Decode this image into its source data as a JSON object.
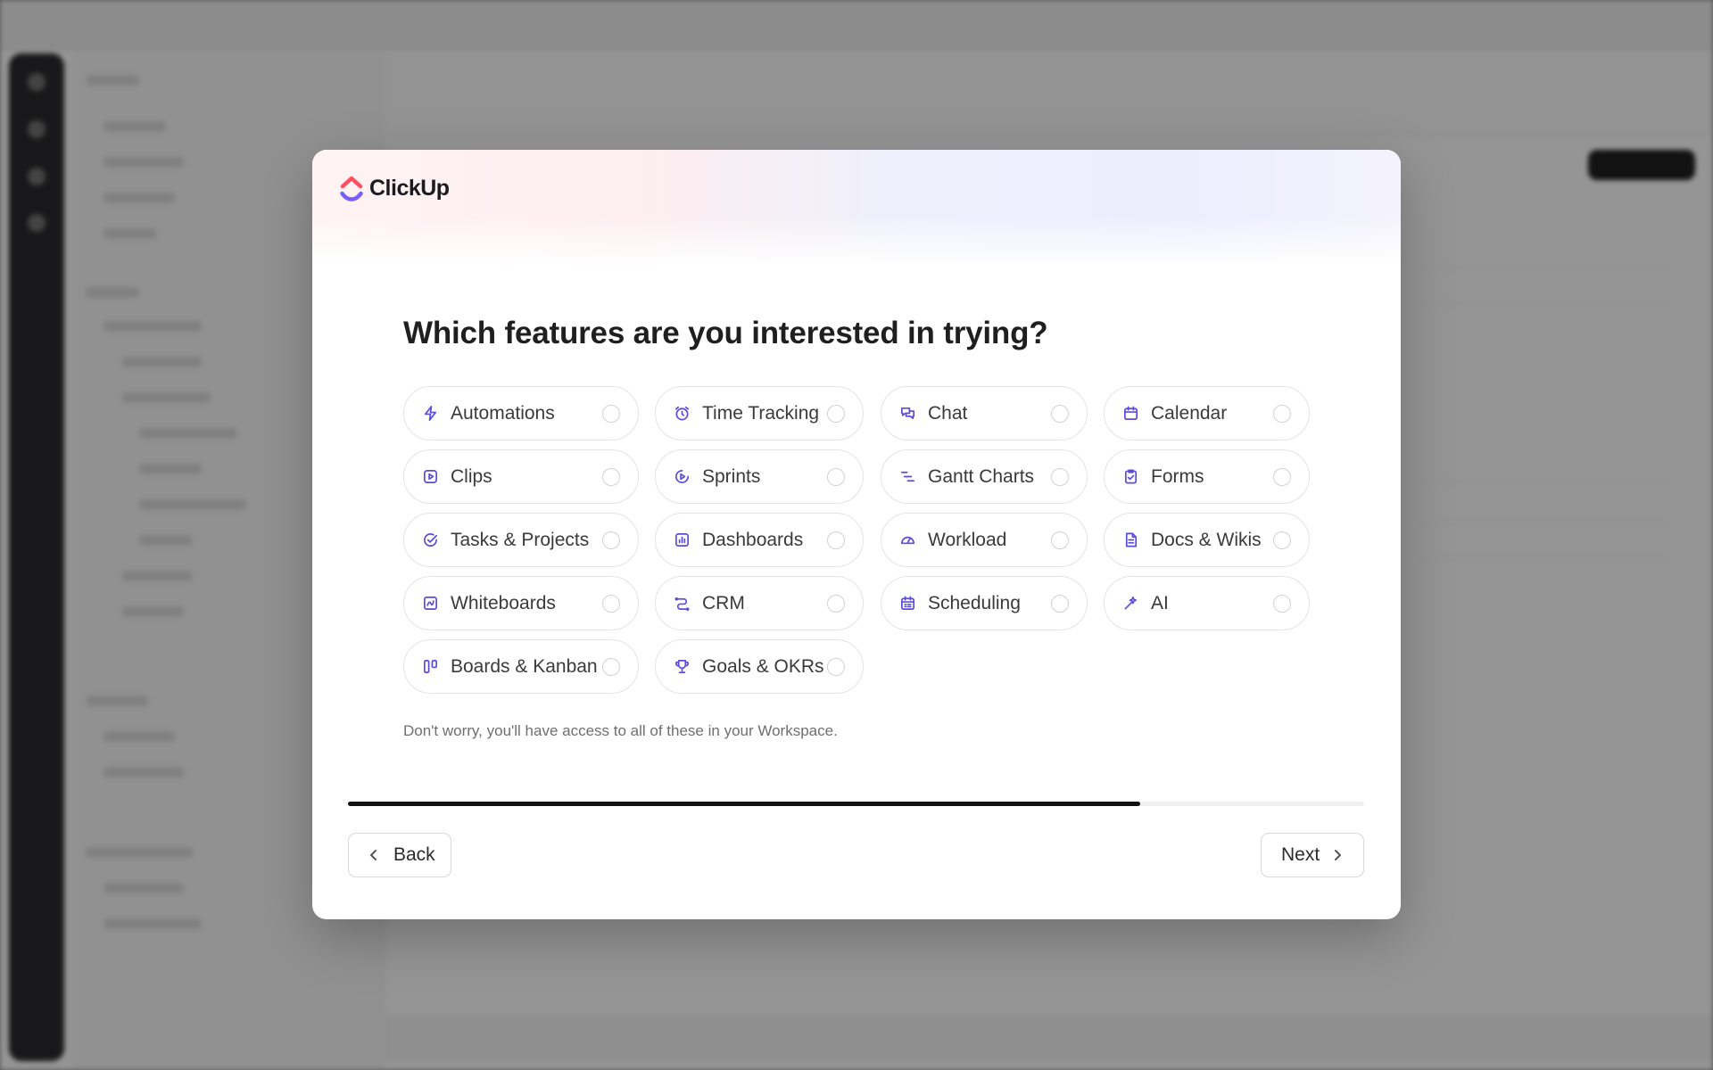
{
  "app": {
    "brand_name": "ClickUp"
  },
  "dialog": {
    "title": "Which features are you interested in trying?",
    "note": "Don't worry, you'll have access to all of these in your Workspace.",
    "progress_fraction": 0.78,
    "back_label": "Back",
    "next_label": "Next",
    "features": [
      {
        "label": "Automations",
        "icon": "bolt-icon",
        "selected": false
      },
      {
        "label": "Time Tracking",
        "icon": "alarm-clock-icon",
        "selected": false
      },
      {
        "label": "Chat",
        "icon": "chat-bubbles-icon",
        "selected": false
      },
      {
        "label": "Calendar",
        "icon": "calendar-icon",
        "selected": false
      },
      {
        "label": "Clips",
        "icon": "video-clip-icon",
        "selected": false
      },
      {
        "label": "Sprints",
        "icon": "sprint-play-icon",
        "selected": false
      },
      {
        "label": "Gantt Charts",
        "icon": "gantt-bars-icon",
        "selected": false
      },
      {
        "label": "Forms",
        "icon": "form-clipboard-icon",
        "selected": false
      },
      {
        "label": "Tasks & Projects",
        "icon": "check-circle-icon",
        "selected": false
      },
      {
        "label": "Dashboards",
        "icon": "bar-chart-icon",
        "selected": false
      },
      {
        "label": "Workload",
        "icon": "gauge-icon",
        "selected": false
      },
      {
        "label": "Docs & Wikis",
        "icon": "document-icon",
        "selected": false
      },
      {
        "label": "Whiteboards",
        "icon": "whiteboard-icon",
        "selected": false
      },
      {
        "label": "CRM",
        "icon": "crm-flow-icon",
        "selected": false
      },
      {
        "label": "Scheduling",
        "icon": "schedule-calendar-icon",
        "selected": false
      },
      {
        "label": "AI",
        "icon": "ai-sparkle-icon",
        "selected": false
      },
      {
        "label": "Boards & Kanban",
        "icon": "kanban-icon",
        "selected": false
      },
      {
        "label": "Goals & OKRs",
        "icon": "trophy-icon",
        "selected": false
      }
    ]
  },
  "colors": {
    "accent_icon": "#5b4ddb",
    "progress_fill": "#121212",
    "logo_red": "#ff4f64",
    "logo_orange": "#ffa12d",
    "logo_blue": "#7b5cff"
  }
}
